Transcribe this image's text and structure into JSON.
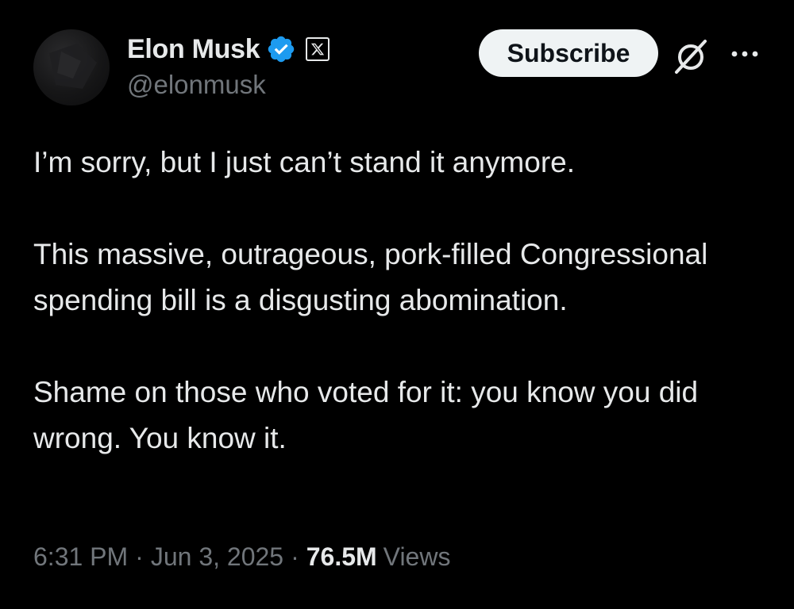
{
  "author": {
    "display_name": "Elon Musk",
    "handle": "@elonmusk",
    "verified_color": "#1d9bf0"
  },
  "header_actions": {
    "subscribe_label": "Subscribe",
    "grok_icon": "grok-icon",
    "more_icon": "more-horizontal-icon"
  },
  "tweet": {
    "paragraphs": [
      "I’m sorry, but I just can’t stand it anymore.",
      "This massive, outrageous, pork-filled Congressional spending bill is a disgusting abomination.",
      "Shame on those who voted for it: you know you did wrong. You know it."
    ]
  },
  "meta": {
    "time": "6:31 PM",
    "date": "Jun 3, 2025",
    "separator": "·",
    "views_count": "76.5M",
    "views_label": "Views"
  },
  "colors": {
    "background": "#000000",
    "primary_text": "#e7e9ea",
    "secondary_text": "#71767b",
    "subscribe_bg": "#eff3f4",
    "subscribe_text": "#0f1419"
  }
}
